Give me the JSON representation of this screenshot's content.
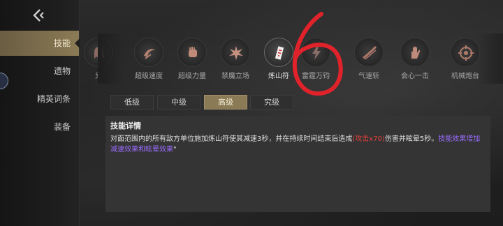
{
  "sidebar": {
    "items": [
      {
        "label": "技能",
        "active": true
      },
      {
        "label": "遗物"
      },
      {
        "label": "精英词条"
      },
      {
        "label": "装备"
      }
    ]
  },
  "skills": [
    {
      "label": "鬼",
      "icon": "ghost-icon"
    },
    {
      "label": "超级速度",
      "icon": "speed-icon"
    },
    {
      "label": "超级力量",
      "icon": "fist-icon"
    },
    {
      "label": "禁魔立场",
      "icon": "burst-icon"
    },
    {
      "label": "炼山符",
      "icon": "talisman-icon",
      "selected": true
    },
    {
      "label": "雷霆万钧",
      "icon": "thunder-icon"
    },
    {
      "label": "气速斩",
      "icon": "slash-icon"
    },
    {
      "label": "会心一击",
      "icon": "palm-icon"
    },
    {
      "label": "机械炮台",
      "icon": "crosshair-icon"
    }
  ],
  "annotation": {
    "text": "6",
    "color": "#e0232a"
  },
  "tabs": [
    {
      "label": "低级"
    },
    {
      "label": "中级"
    },
    {
      "label": "高级",
      "active": true
    },
    {
      "label": "究级"
    }
  ],
  "detail": {
    "title": "技能详情",
    "text_part1": "对面范围内的所有敌方单位施加炼山符使其减速3秒，并在持续时间结束后造成",
    "text_red": "(攻击x70)",
    "text_part2": "伤害并眩晕5秒。",
    "text_purple": "技能效果增加减速效果和眩晕效果",
    "text_end": "\""
  },
  "colors": {
    "accent": "#8a7a55",
    "damage": "#e0403a",
    "upgrade": "#9a6cff"
  }
}
